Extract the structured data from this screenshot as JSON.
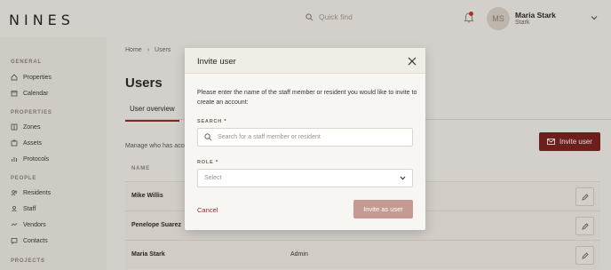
{
  "app": {
    "logo": "NINES"
  },
  "header": {
    "search_placeholder": "Quick find",
    "user": {
      "initials": "MS",
      "name": "Maria Stark",
      "subtitle": "Stark"
    }
  },
  "sidebar": {
    "sections": [
      {
        "title": "GENERAL",
        "items": [
          "Properties",
          "Calendar"
        ]
      },
      {
        "title": "PROPERTIES",
        "items": [
          "Zones",
          "Assets",
          "Protocols"
        ]
      },
      {
        "title": "PEOPLE",
        "items": [
          "Residents",
          "Staff",
          "Vendors",
          "Contacts"
        ]
      },
      {
        "title": "PROJECTS",
        "items": []
      }
    ]
  },
  "breadcrumb": {
    "home": "Home",
    "separator": "›",
    "current": "Users"
  },
  "page": {
    "title": "Users",
    "tab": "User overview",
    "manage_text": "Manage who has acce",
    "invite_button": "Invite user"
  },
  "table": {
    "columns": [
      "NAME"
    ],
    "rows": [
      {
        "name": "Mike Willis",
        "role": ""
      },
      {
        "name": "Penelope Suarez",
        "role": ""
      },
      {
        "name": "Maria Stark",
        "role": "Admin"
      }
    ]
  },
  "modal": {
    "title": "Invite user",
    "description": "Please enter the name of the staff member or resident you would like to invite to create an account:",
    "search_label": "SEARCH",
    "search_placeholder": "Search for a staff member or resident",
    "role_label": "ROLE",
    "required_mark": "*",
    "role_placeholder": "Select",
    "cancel": "Cancel",
    "submit": "Invite as user"
  },
  "colors": {
    "accent": "#7b1f1f",
    "submit_disabled": "#c49a93",
    "background": "#f6f3ee"
  }
}
